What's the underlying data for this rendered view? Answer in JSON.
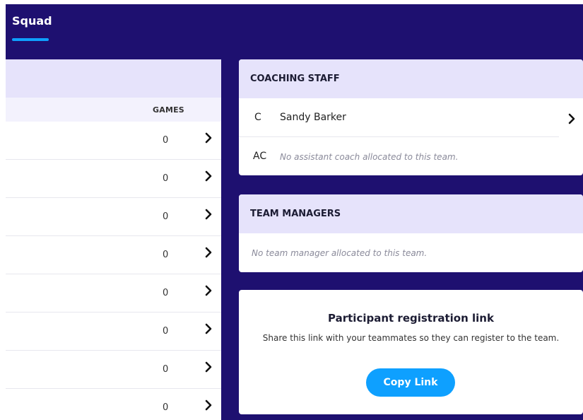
{
  "tabs": {
    "active_label": "Squad"
  },
  "squad": {
    "games_header": "GAMES",
    "rows": [
      {
        "games": "0"
      },
      {
        "games": "0"
      },
      {
        "games": "0"
      },
      {
        "games": "0"
      },
      {
        "games": "0"
      },
      {
        "games": "0"
      },
      {
        "games": "0"
      },
      {
        "games": "0"
      }
    ]
  },
  "coaching_staff": {
    "title": "COACHING STAFF",
    "coach_role": "C",
    "coach_name": "Sandy Barker",
    "assistant_role": "AC",
    "assistant_note": "No assistant coach allocated to this team."
  },
  "team_managers": {
    "title": "TEAM MANAGERS",
    "note": "No team manager allocated to this team."
  },
  "registration": {
    "title": "Participant registration link",
    "description": "Share this link with your teammates so they can register to the team.",
    "button_label": "Copy Link"
  },
  "colors": {
    "header_bg": "#1e1070",
    "accent": "#0ea0ff",
    "card_header_bg": "#e6e3fb"
  },
  "icons": {
    "row_action": "chevron-right-icon"
  }
}
